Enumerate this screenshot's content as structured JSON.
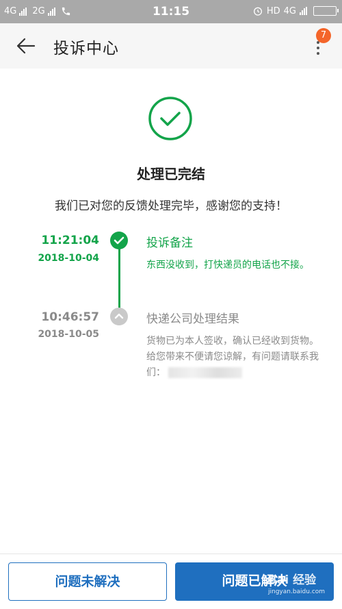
{
  "status_bar": {
    "network1": "4G",
    "network2": "2G",
    "time": "11:15",
    "hd": "HD",
    "network3": "4G"
  },
  "header": {
    "title": "投诉中心",
    "badge": "7"
  },
  "result": {
    "title": "处理已完结",
    "subtitle": "我们已对您的反馈处理完毕，感谢您的支持！"
  },
  "timeline": [
    {
      "time": "11:21:04",
      "date": "2018-10-04",
      "title": "投诉备注",
      "body": "东西没收到，打快递员的电话也不接。"
    },
    {
      "time": "10:46:57",
      "date": "2018-10-05",
      "title": "快递公司处理结果",
      "body": "货物已为本人签收，确认已经收到货物。给您带来不便请您谅解，有问题请联系我们："
    }
  ],
  "buttons": {
    "unresolved": "问题未解决",
    "resolved": "问题已解决"
  },
  "watermark": {
    "brand": "Bai 经验",
    "url": "jingyan.baidu.com"
  },
  "colors": {
    "accent_green": "#13a44a",
    "primary_blue": "#1f6fbf",
    "badge_orange": "#f4652a"
  }
}
